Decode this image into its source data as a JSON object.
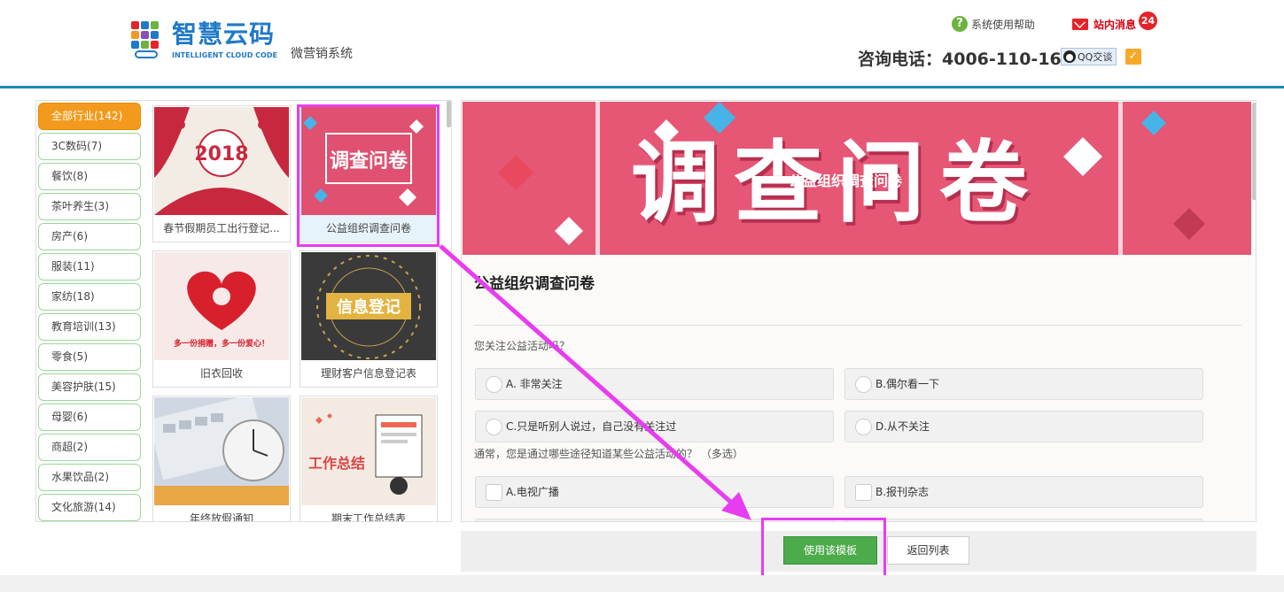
{
  "brand": {
    "name": "智慧云码",
    "subtitle": "INTELLIGENT CLOUD CODE",
    "tagline": "微营销系统"
  },
  "header": {
    "help_label": "系统使用帮助",
    "message_label": "站内消息",
    "message_count": "24",
    "phone_text": "咨询电话：4006-110-166",
    "qq_label": "QQ交谈"
  },
  "categories": [
    "全部行业(142)",
    "3C数码(7)",
    "餐饮(8)",
    "茶叶养生(3)",
    "房产(6)",
    "服装(11)",
    "家纺(18)",
    "教育培训(13)",
    "零食(5)",
    "美容护肤(15)",
    "母婴(6)",
    "商超(2)",
    "水果饮品(2)",
    "文化旅游(14)"
  ],
  "templates": [
    "春节假期员工出行登记...",
    "公益组织调查问卷",
    "旧衣回收",
    "理财客户信息登记表",
    "年终放假通知",
    "期末工作总结表"
  ],
  "thumb_text": {
    "t1_year": "2018",
    "t2_title": "调查问卷",
    "t3_caption": "多一份捐赠，多一份爱心！",
    "t4_title": "信息登记",
    "t6_title": "工作总结"
  },
  "preview": {
    "banner_title": "调查问卷",
    "banner_subtitle": "公益组织调查问卷",
    "title": "公益组织调查问卷",
    "q1": "您关注公益活动吗？",
    "q1_options": [
      "A. 非常关注",
      "B.偶尔看一下",
      "C.只是听别人说过，自己没有关注过",
      "D.从不关注"
    ],
    "q2": "通常，您是通过哪些途径知道某些公益活动的？ （多选）",
    "q2_options": [
      "A.电视广播",
      "B.报刊杂志"
    ]
  },
  "actions": {
    "use_template": "使用该模板",
    "back_to_list": "返回列表"
  },
  "colors": {
    "accent": "#1a8bb5",
    "active_category": "#f39a1e",
    "highlight": "#e83cf0",
    "primary_button": "#4cab4a"
  }
}
